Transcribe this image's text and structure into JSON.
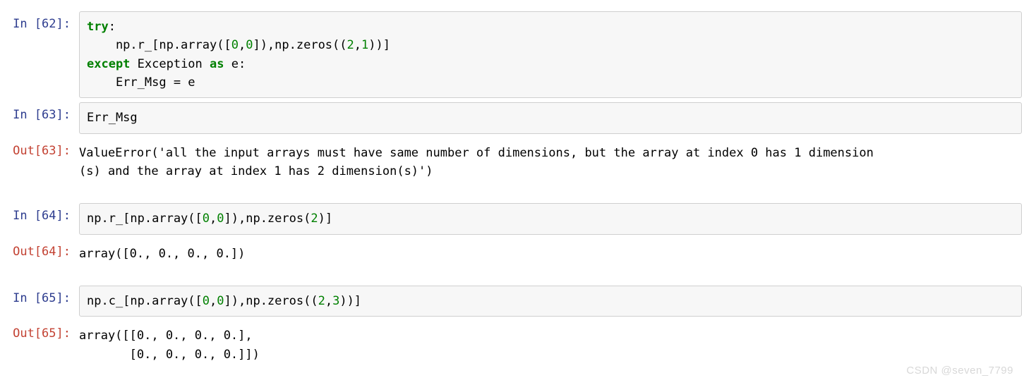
{
  "watermark": "CSDN @seven_7799",
  "cells": {
    "c62": {
      "in_label": "In ",
      "in_num": "[62]:",
      "code": {
        "l1a": "try",
        "l1b": ":",
        "l2a": "    np.r_[np.array([",
        "l2b": "0",
        "l2c": ",",
        "l2d": "0",
        "l2e": "]),np.zeros((",
        "l2f": "2",
        "l2g": ",",
        "l2h": "1",
        "l2i": "))]",
        "l3a": "except",
        "l3b": " Exception ",
        "l3c": "as",
        "l3d": " e:",
        "l4": "    Err_Msg = e"
      }
    },
    "c63": {
      "in_label": "In ",
      "in_num": "[63]:",
      "code": "Err_Msg",
      "out_label": "Out",
      "out_num": "[63]:",
      "output": "ValueError('all the input arrays must have same number of dimensions, but the array at index 0 has 1 dimension\n(s) and the array at index 1 has 2 dimension(s)')"
    },
    "c64": {
      "in_label": "In ",
      "in_num": "[64]:",
      "code": {
        "a": "np.r_[np.array([",
        "b": "0",
        "c": ",",
        "d": "0",
        "e": "]),np.zeros(",
        "f": "2",
        "g": ")]"
      },
      "out_label": "Out",
      "out_num": "[64]:",
      "output": "array([0., 0., 0., 0.])"
    },
    "c65": {
      "in_label": "In ",
      "in_num": "[65]:",
      "code": {
        "a": "np.c_[np.array([",
        "b": "0",
        "c": ",",
        "d": "0",
        "e": "]),np.zeros((",
        "f": "2",
        "g": ",",
        "h": "3",
        "i": "))]"
      },
      "out_label": "Out",
      "out_num": "[65]:",
      "output": "array([[0., 0., 0., 0.],\n       [0., 0., 0., 0.]])"
    }
  }
}
